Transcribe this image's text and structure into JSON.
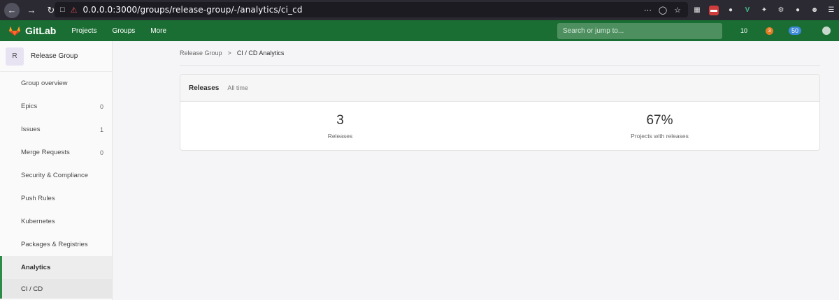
{
  "browser": {
    "url": "0.0.0.0:3000/groups/release-group/-/analytics/ci_cd",
    "more_icon": "ellipsis-icon",
    "colors": {
      "chrome": "#2b2a33",
      "url_bg": "#1c1b22"
    }
  },
  "topnav": {
    "logo_text": "GitLab",
    "links": [
      "Projects",
      "Groups",
      "More"
    ],
    "search_placeholder": "Search or jump to...",
    "issues_count": "10",
    "mr_count": "3",
    "todo_count": "50",
    "colors": {
      "bar": "#1a6e33",
      "search": "#4e8f5f"
    }
  },
  "sidebar": {
    "group_initial": "R",
    "group_name": "Release Group",
    "items": [
      {
        "label": "Group overview",
        "count": ""
      },
      {
        "label": "Epics",
        "count": "0"
      },
      {
        "label": "Issues",
        "count": "1"
      },
      {
        "label": "Merge Requests",
        "count": "0"
      },
      {
        "label": "Security & Compliance",
        "count": ""
      },
      {
        "label": "Push Rules",
        "count": ""
      },
      {
        "label": "Kubernetes",
        "count": ""
      },
      {
        "label": "Packages & Registries",
        "count": ""
      },
      {
        "label": "Analytics",
        "count": ""
      },
      {
        "label": "CI / CD",
        "count": ""
      }
    ]
  },
  "breadcrumb": {
    "parent": "Release Group",
    "separator": ">",
    "current": "CI / CD Analytics"
  },
  "releases_panel": {
    "title": "Releases",
    "subtitle": "All time",
    "stats": [
      {
        "value": "3",
        "label": "Releases"
      },
      {
        "value": "67%",
        "label": "Projects with releases"
      }
    ]
  }
}
